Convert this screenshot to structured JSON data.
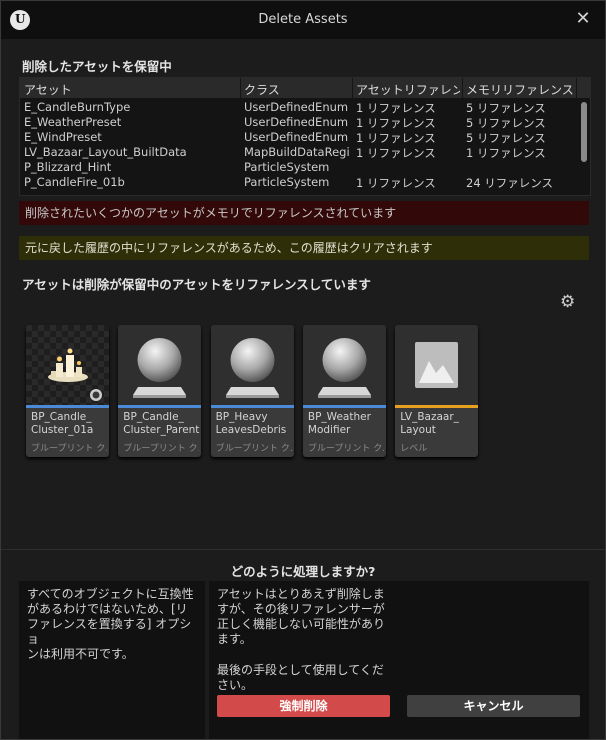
{
  "window": {
    "title": "Delete Assets",
    "logo_text": "U",
    "close_glyph": "✕"
  },
  "pending_section": {
    "title": "削除したアセットを保留中"
  },
  "table": {
    "columns": [
      "アセット",
      "クラス",
      "アセットリファレンス",
      "メモリリファレンス"
    ],
    "rows": [
      [
        "E_CandleBurnType",
        "UserDefinedEnum",
        "1 リファレンス",
        "5 リファレンス"
      ],
      [
        "E_WeatherPreset",
        "UserDefinedEnum",
        "1 リファレンス",
        "5 リファレンス"
      ],
      [
        "E_WindPreset",
        "UserDefinedEnum",
        "1 リファレンス",
        "5 リファレンス"
      ],
      [
        "LV_Bazaar_Layout_BuiltData",
        "MapBuildDataRegistry",
        "1 リファレンス",
        "1 リファレンス"
      ],
      [
        "P_Blizzard_Hint",
        "ParticleSystem",
        "",
        ""
      ],
      [
        "P_CandleFire_01b",
        "ParticleSystem",
        "1 リファレンス",
        "24 リファレンス"
      ]
    ]
  },
  "banners": {
    "memory_warning": "削除されたいくつかのアセットがメモリでリファレンスされています",
    "history_warning": "元に戻した履歴の中にリファレンスがあるため、この履歴はクリアされます"
  },
  "referencing_section": {
    "title": "アセットは削除が保留中のアセットをリファレンスしています"
  },
  "tiles": [
    {
      "name": "BP_Candle_\nCluster_01a",
      "type": "ブループリント ク…",
      "bar_color": "#4a8ad8"
    },
    {
      "name": "BP_Candle_\nCluster_Parent",
      "type": "ブループリント ク…",
      "bar_color": "#4a8ad8"
    },
    {
      "name": "BP_Heavy\nLeavesDebris",
      "type": "ブループリント ク…",
      "bar_color": "#4a8ad8"
    },
    {
      "name": "BP_Weather\nModifier",
      "type": "ブループリント ク…",
      "bar_color": "#4a8ad8"
    },
    {
      "name": "LV_Bazaar_\nLayout",
      "type": "レベル",
      "bar_color": "#e8a020"
    }
  ],
  "footer": {
    "question": "どのように処理しますか?",
    "left_text": "すべてのオブジェクトに互換性\nがあるわけではないため、[リ\nファレンスを置換する] オプショ\nンは利用不可です。",
    "right_text_1": "アセットはとりあえず削除しま\nすが、その後リファレンサーが\n正しく機能しない可能性があり\nます。",
    "right_text_2": "最後の手段として使用してくだ\nさい。",
    "force_delete": "強制削除",
    "cancel": "キャンセル"
  },
  "icons": {
    "settings": "gear-icon",
    "close": "close-icon"
  }
}
